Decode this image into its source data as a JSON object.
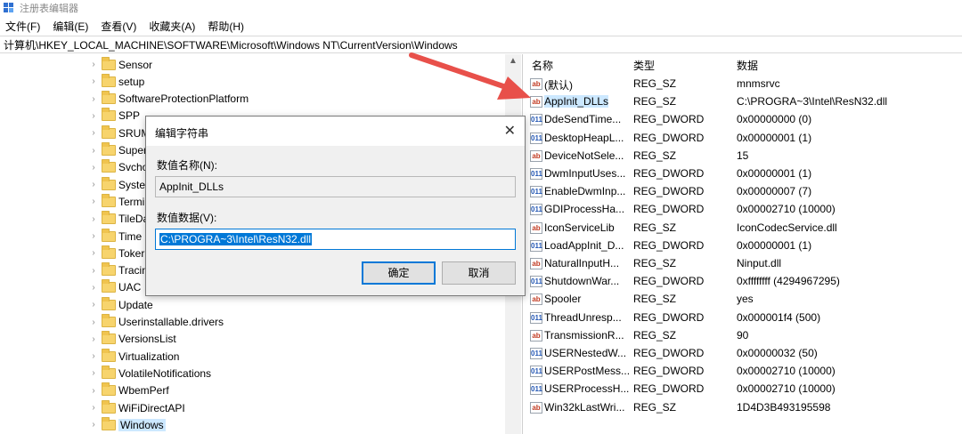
{
  "window": {
    "title": "注册表编辑器"
  },
  "menu": [
    "文件(F)",
    "编辑(E)",
    "查看(V)",
    "收藏夹(A)",
    "帮助(H)"
  ],
  "address": "计算机\\HKEY_LOCAL_MACHINE\\SOFTWARE\\Microsoft\\Windows NT\\CurrentVersion\\Windows",
  "tree": [
    {
      "label": "Sensor"
    },
    {
      "label": "setup"
    },
    {
      "label": "SoftwareProtectionPlatform"
    },
    {
      "label": "SPP"
    },
    {
      "label": "SRUM"
    },
    {
      "label": "Super"
    },
    {
      "label": "Svcho"
    },
    {
      "label": "Syster"
    },
    {
      "label": "Termi"
    },
    {
      "label": "TileDa"
    },
    {
      "label": "Time "
    },
    {
      "label": "Toker"
    },
    {
      "label": "Tracin"
    },
    {
      "label": "UAC"
    },
    {
      "label": "Update"
    },
    {
      "label": "Userinstallable.drivers"
    },
    {
      "label": "VersionsList"
    },
    {
      "label": "Virtualization"
    },
    {
      "label": "VolatileNotifications"
    },
    {
      "label": "WbemPerf"
    },
    {
      "label": "WiFiDirectAPI"
    },
    {
      "label": "Windows"
    }
  ],
  "values_header": {
    "name": "名称",
    "type": "类型",
    "data": "数据"
  },
  "values": [
    {
      "name": "(默认)",
      "type": "REG_SZ",
      "data": "mnmsrvc",
      "icon": "string-value-icon"
    },
    {
      "name": "AppInit_DLLs",
      "type": "REG_SZ",
      "data": "C:\\PROGRA~3\\Intel\\ResN32.dll",
      "icon": "string-value-icon"
    },
    {
      "name": "DdeSendTime...",
      "type": "REG_DWORD",
      "data": "0x00000000 (0)",
      "icon": "dword-value-icon"
    },
    {
      "name": "DesktopHeapL...",
      "type": "REG_DWORD",
      "data": "0x00000001 (1)",
      "icon": "dword-value-icon"
    },
    {
      "name": "DeviceNotSele...",
      "type": "REG_SZ",
      "data": "15",
      "icon": "string-value-icon"
    },
    {
      "name": "DwmInputUses...",
      "type": "REG_DWORD",
      "data": "0x00000001 (1)",
      "icon": "dword-value-icon"
    },
    {
      "name": "EnableDwmInp...",
      "type": "REG_DWORD",
      "data": "0x00000007 (7)",
      "icon": "dword-value-icon"
    },
    {
      "name": "GDIProcessHa...",
      "type": "REG_DWORD",
      "data": "0x00002710 (10000)",
      "icon": "dword-value-icon"
    },
    {
      "name": "IconServiceLib",
      "type": "REG_SZ",
      "data": "IconCodecService.dll",
      "icon": "string-value-icon"
    },
    {
      "name": "LoadAppInit_D...",
      "type": "REG_DWORD",
      "data": "0x00000001 (1)",
      "icon": "dword-value-icon"
    },
    {
      "name": "NaturalInputH...",
      "type": "REG_SZ",
      "data": "Ninput.dll",
      "icon": "string-value-icon"
    },
    {
      "name": "ShutdownWar...",
      "type": "REG_DWORD",
      "data": "0xffffffff (4294967295)",
      "icon": "dword-value-icon"
    },
    {
      "name": "Spooler",
      "type": "REG_SZ",
      "data": "yes",
      "icon": "string-value-icon"
    },
    {
      "name": "ThreadUnresp...",
      "type": "REG_DWORD",
      "data": "0x000001f4 (500)",
      "icon": "dword-value-icon"
    },
    {
      "name": "TransmissionR...",
      "type": "REG_SZ",
      "data": "90",
      "icon": "string-value-icon"
    },
    {
      "name": "USERNestedW...",
      "type": "REG_DWORD",
      "data": "0x00000032 (50)",
      "icon": "dword-value-icon"
    },
    {
      "name": "USERPostMess...",
      "type": "REG_DWORD",
      "data": "0x00002710 (10000)",
      "icon": "dword-value-icon"
    },
    {
      "name": "USERProcessH...",
      "type": "REG_DWORD",
      "data": "0x00002710 (10000)",
      "icon": "dword-value-icon"
    },
    {
      "name": "Win32kLastWri...",
      "type": "REG_SZ",
      "data": "1D4D3B493195598",
      "icon": "string-value-icon"
    }
  ],
  "dialog": {
    "title": "编辑字符串",
    "name_label": "数值名称(N):",
    "name_value": "AppInit_DLLs",
    "data_label": "数值数据(V):",
    "data_value": "C:\\PROGRA~3\\Intel\\ResN32.dll",
    "ok": "确定",
    "cancel": "取消"
  },
  "icons": {
    "string": "ab",
    "dword": "011"
  },
  "colors": {
    "selection": "#cce8ff",
    "accent": "#0078d7",
    "annotation_arrow": "#e8504a"
  }
}
